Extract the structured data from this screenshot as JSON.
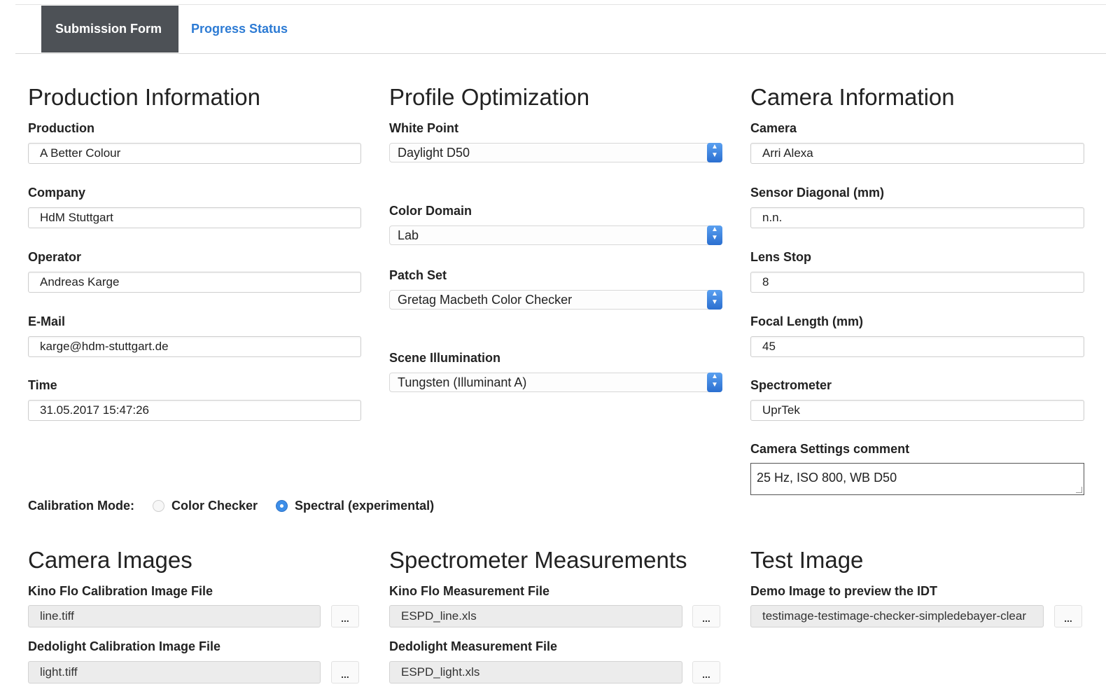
{
  "tabs": [
    {
      "label": "Submission Form",
      "active": true
    },
    {
      "label": "Progress Status",
      "active": false
    }
  ],
  "production": {
    "heading": "Production Information",
    "fields": [
      {
        "label": "Production",
        "value": "A Better Colour"
      },
      {
        "label": "Company",
        "value": "HdM Stuttgart"
      },
      {
        "label": "Operator",
        "value": "Andreas Karge"
      },
      {
        "label": "E-Mail",
        "value": "karge@hdm-stuttgart.de"
      },
      {
        "label": "Time",
        "value": "31.05.2017 15:47:26"
      }
    ]
  },
  "profile": {
    "heading": "Profile Optimization",
    "selects": [
      {
        "label": "White Point",
        "value": "Daylight D50"
      },
      {
        "label": "Color Domain",
        "value": "Lab"
      },
      {
        "label": "Patch Set",
        "value": "Gretag Macbeth Color Checker"
      },
      {
        "label": "Scene Illumination",
        "value": "Tungsten (Illuminant A)"
      }
    ]
  },
  "camera": {
    "heading": "Camera Information",
    "fields": [
      {
        "label": "Camera",
        "value": "Arri Alexa"
      },
      {
        "label": "Sensor Diagonal (mm)",
        "value": "n.n."
      },
      {
        "label": "Lens Stop",
        "value": "8"
      },
      {
        "label": "Focal Length (mm)",
        "value": "45"
      },
      {
        "label": "Spectrometer",
        "value": "UprTek"
      }
    ],
    "comment_label": "Camera Settings comment",
    "comment_value": "25 Hz, ISO 800, WB D50"
  },
  "calibration": {
    "label": "Calibration Mode:",
    "options": [
      {
        "label": "Color Checker",
        "selected": false
      },
      {
        "label": "Spectral (experimental)",
        "selected": true
      }
    ]
  },
  "camera_images": {
    "heading": "Camera Images",
    "files": [
      {
        "label": "Kino Flo Calibration Image File",
        "value": "line.tiff",
        "browse": "..."
      },
      {
        "label": "Dedolight Calibration Image File",
        "value": "light.tiff",
        "browse": "..."
      }
    ]
  },
  "spectrometer": {
    "heading": "Spectrometer Measurements",
    "files": [
      {
        "label": "Kino Flo Measurement File",
        "value": "ESPD_line.xls",
        "browse": "..."
      },
      {
        "label": "Dedolight Measurement File",
        "value": "ESPD_light.xls",
        "browse": "..."
      }
    ]
  },
  "test_image": {
    "heading": "Test Image",
    "files": [
      {
        "label": "Demo Image to preview the IDT",
        "value": "testimage-testimage-checker-simpledebayer-clear",
        "browse": "..."
      }
    ]
  },
  "colors": {
    "tab_active_bg": "#4d5156",
    "link": "#2d7bd4",
    "accent": "#3d8ee8"
  }
}
